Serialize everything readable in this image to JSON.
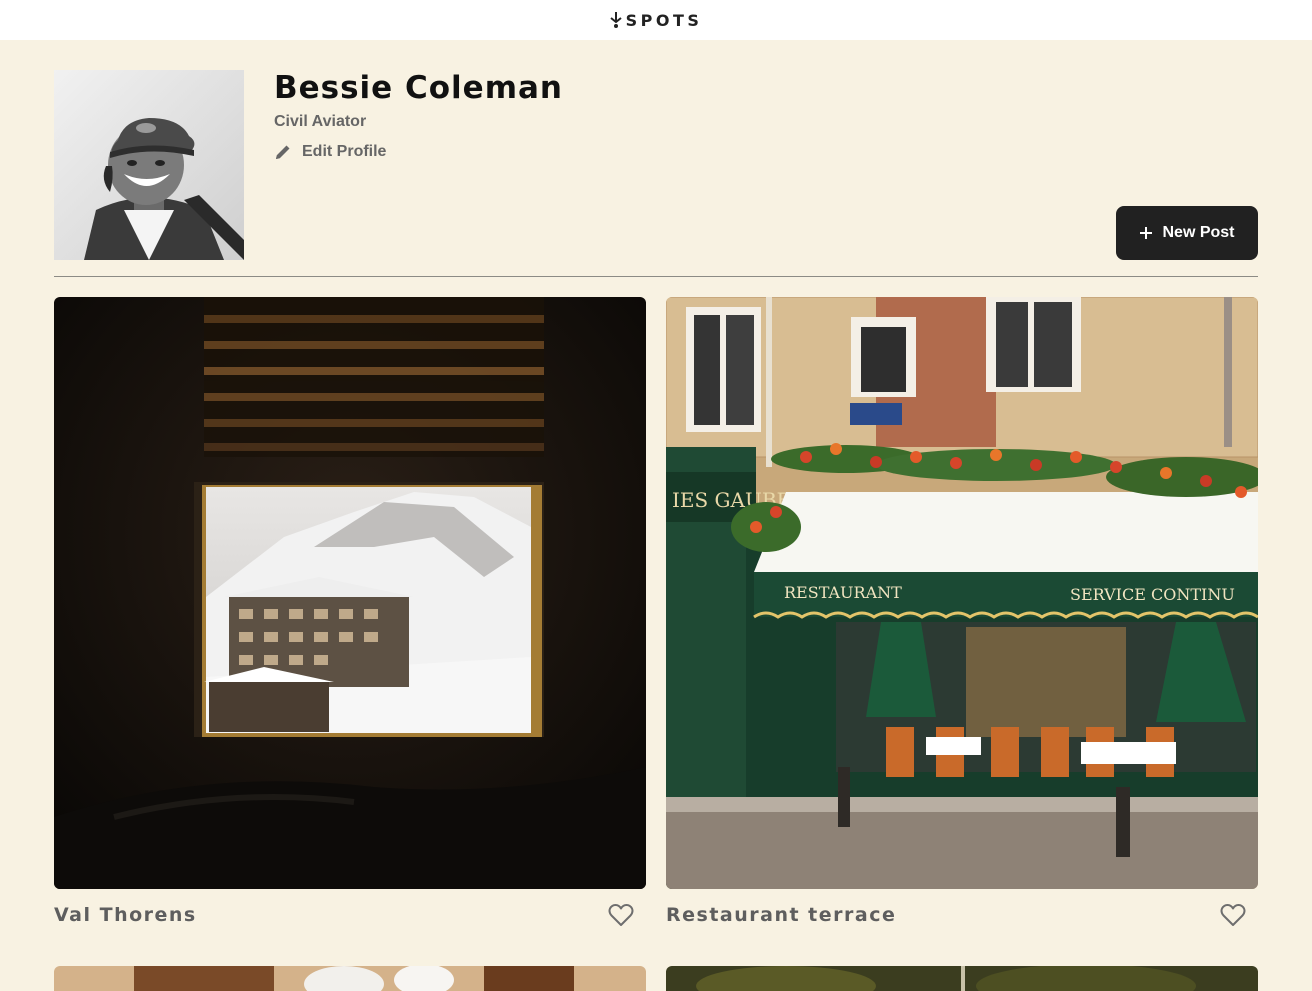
{
  "header": {
    "logo_text": "SPOTS"
  },
  "profile": {
    "name": "Bessie Coleman",
    "role": "Civil Aviator",
    "edit_label": "Edit Profile"
  },
  "actions": {
    "new_post_label": "New Post"
  },
  "cards": [
    {
      "title": "Val Thorens",
      "liked": false
    },
    {
      "title": "Restaurant terrace",
      "liked": false
    }
  ],
  "colors": {
    "page_background": "#f8f2e2",
    "header_background": "#ffffff",
    "primary_button": "#212121",
    "muted_text": "#666666"
  }
}
